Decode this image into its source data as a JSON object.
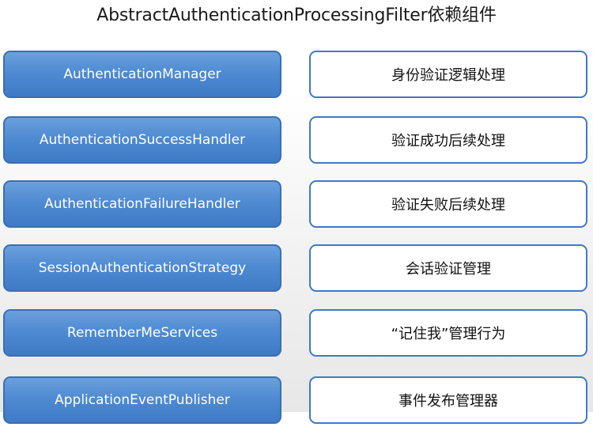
{
  "title": "AbstractAuthenticationProcessingFilter依赖组件",
  "rows": [
    {
      "component": "AuthenticationManager",
      "description": "身份验证逻辑处理"
    },
    {
      "component": "AuthenticationSuccessHandler",
      "description": "验证成功后续处理"
    },
    {
      "component": "AuthenticationFailureHandler",
      "description": "验证失败后续处理"
    },
    {
      "component": "SessionAuthenticationStrategy",
      "description": "会话验证管理"
    },
    {
      "component": "RememberMeServices",
      "description": "“记住我”管理行为"
    },
    {
      "component": "ApplicationEventPublisher",
      "description": "事件发布管理器"
    }
  ],
  "colors": {
    "component_fill": "#4f8bd2",
    "component_border": "#3a6fb4",
    "description_border": "#3f79c6"
  }
}
